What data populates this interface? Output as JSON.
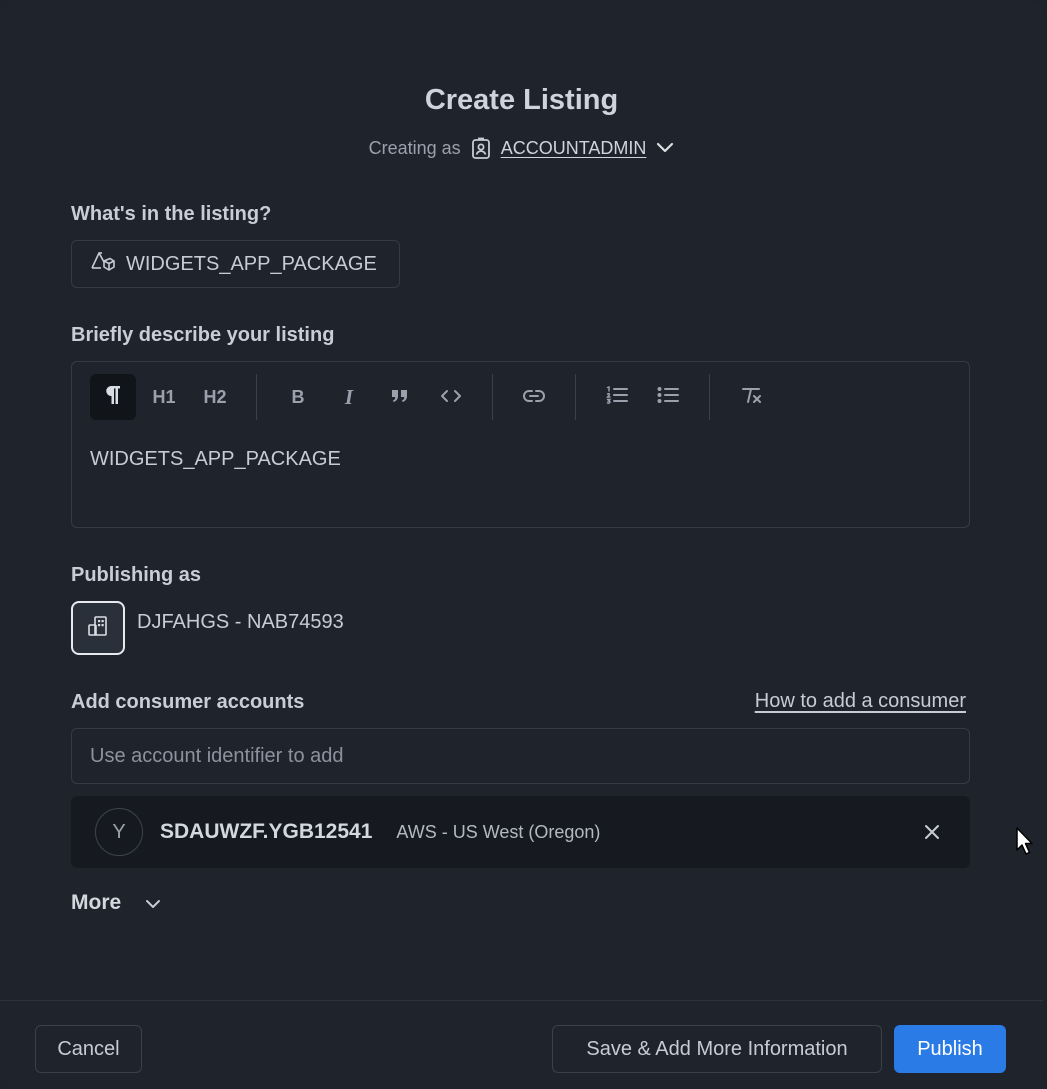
{
  "dialog": {
    "title": "Create Listing",
    "creating_as_label": "Creating as",
    "creating_as_role": "ACCOUNTADMIN"
  },
  "contents": {
    "label": "What's in the listing?",
    "package_name": "WIDGETS_APP_PACKAGE"
  },
  "description": {
    "label": "Briefly describe your listing",
    "toolbar": {
      "h1": "H1",
      "h2": "H2",
      "bold": "B",
      "italic": "I"
    },
    "text": "WIDGETS_APP_PACKAGE"
  },
  "publishing": {
    "label": "Publishing as",
    "account": "DJFAHGS - NAB74593"
  },
  "consumers": {
    "label": "Add consumer accounts",
    "help_link": "How to add a consumer",
    "input_placeholder": "Use account identifier to add",
    "items": [
      {
        "avatar_letter": "Y",
        "account_id": "SDAUWZF.YGB12541",
        "region": "AWS - US West (Oregon)"
      }
    ]
  },
  "more": {
    "label": "More"
  },
  "footer": {
    "cancel": "Cancel",
    "save_more": "Save & Add More Information",
    "publish": "Publish"
  },
  "colors": {
    "background": "#1f242c",
    "accent": "#2a7be6",
    "consumer_row": "#161a20"
  }
}
